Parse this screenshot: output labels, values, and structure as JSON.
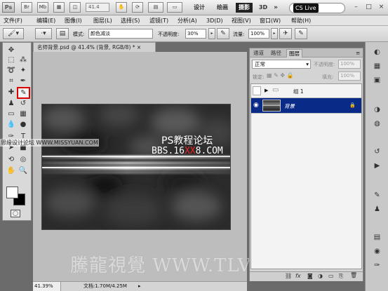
{
  "app": {
    "logo": "Ps",
    "zoom": "41.4",
    "workspaces": [
      "设计",
      "绘画",
      "摄影",
      "3D"
    ],
    "more": "»",
    "cs_live": "CS Live"
  },
  "menu": [
    "文件(F)",
    "编辑(E)",
    "图像(I)",
    "图层(L)",
    "选择(S)",
    "滤镜(T)",
    "分析(A)",
    "3D(D)",
    "视图(V)",
    "窗口(W)",
    "帮助(H)"
  ],
  "options": {
    "mode_label": "模式:",
    "mode_value": "颜色减淡",
    "opacity_label": "不透明度:",
    "opacity_value": "30%",
    "flow_label": "流量:",
    "flow_value": "100%"
  },
  "document": {
    "tab": "名师背景.psd @ 41.4% (背景, RGB/8) *",
    "close": "×"
  },
  "canvas": {
    "line1": "PS教程论坛",
    "line2_a": "BBS.16",
    "line2_b": "XX",
    "line2_c": "8.COM"
  },
  "side_watermark": "思缘设计论坛 WWW.MISSYUAN.COM",
  "watermark": "騰龍視覺 WWW.TLVI.NET",
  "status": {
    "zoom": "41.39%",
    "doc": "文档:1.70M/4.25M"
  },
  "layers_panel": {
    "tabs": [
      "通道",
      "路径",
      "图层"
    ],
    "blend": "正常",
    "opacity_label": "不透明度:",
    "opacity_value": "100%",
    "lock_label": "锁定:",
    "fill_label": "填充:",
    "fill_value": "100%",
    "layers": [
      {
        "name": "组 1",
        "type": "group"
      },
      {
        "name": "背景",
        "type": "layer",
        "selected": true
      }
    ],
    "footer": [
      "⛓",
      "fx",
      "◙",
      "◑",
      "▭",
      "⎘",
      "🗑"
    ]
  },
  "colors": {
    "selected_layer": "#0a2a88",
    "tool_highlight": "#dd0000"
  }
}
